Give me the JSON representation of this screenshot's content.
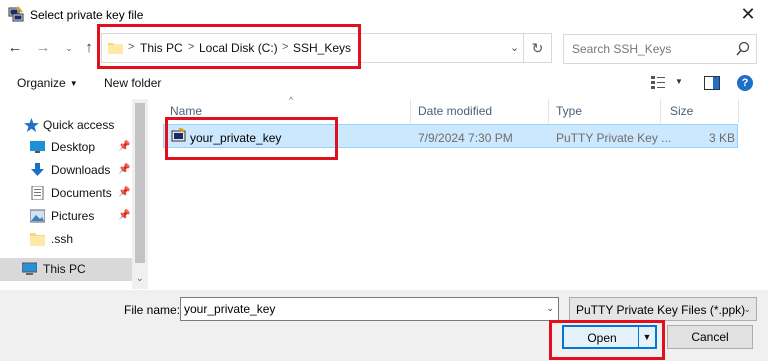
{
  "window": {
    "title": "Select private key file",
    "app_icon": "putty-icon",
    "close_glyph": "✕"
  },
  "nav": {
    "back_glyph": "←",
    "forward_glyph": "→",
    "recent_glyph": "⌄",
    "up_glyph": "↑"
  },
  "address": {
    "crumbs": [
      "This PC",
      "Local Disk (C:)",
      "SSH_Keys"
    ],
    "separator": ">",
    "dropdown_glyph": "⌄",
    "refresh_glyph": "↻"
  },
  "search": {
    "placeholder": "Search SSH_Keys"
  },
  "toolbar": {
    "organize_label": "Organize",
    "organize_caret": "▼",
    "new_folder_label": "New folder",
    "view_caret": "▼",
    "help_glyph": "?"
  },
  "sidebar": {
    "items": [
      {
        "label": "Quick access",
        "icon": "star-icon"
      },
      {
        "label": "Desktop",
        "icon": "desktop-icon",
        "pinned": true
      },
      {
        "label": "Downloads",
        "icon": "download-icon",
        "pinned": true
      },
      {
        "label": "Documents",
        "icon": "documents-icon",
        "pinned": true
      },
      {
        "label": "Pictures",
        "icon": "pictures-icon",
        "pinned": true
      },
      {
        "label": ".ssh",
        "icon": "folder-icon"
      },
      {
        "label": "This PC",
        "icon": "computer-icon",
        "selected": true
      }
    ],
    "scroll_down_glyph": "⌄"
  },
  "file_list": {
    "sort_glyph": "^",
    "columns": [
      "Name",
      "Date modified",
      "Type",
      "Size"
    ],
    "rows": [
      {
        "name": "your_private_key",
        "date_modified": "7/9/2024 7:30 PM",
        "type": "PuTTY Private Key ...",
        "size": "3 KB",
        "icon": "putty-key-file-icon",
        "selected": true
      }
    ]
  },
  "footer": {
    "file_name_label": "File name:",
    "file_name_value": "your_private_key",
    "file_name_caret": "⌄",
    "filter_value": "PuTTY Private Key Files (*.ppk)",
    "filter_caret": "⌄",
    "open_label": "Open",
    "open_split_glyph": "▼",
    "cancel_label": "Cancel"
  },
  "colors": {
    "annotation": "#e0101c",
    "accent": "#0078d7",
    "selection": "#cce8ff"
  }
}
